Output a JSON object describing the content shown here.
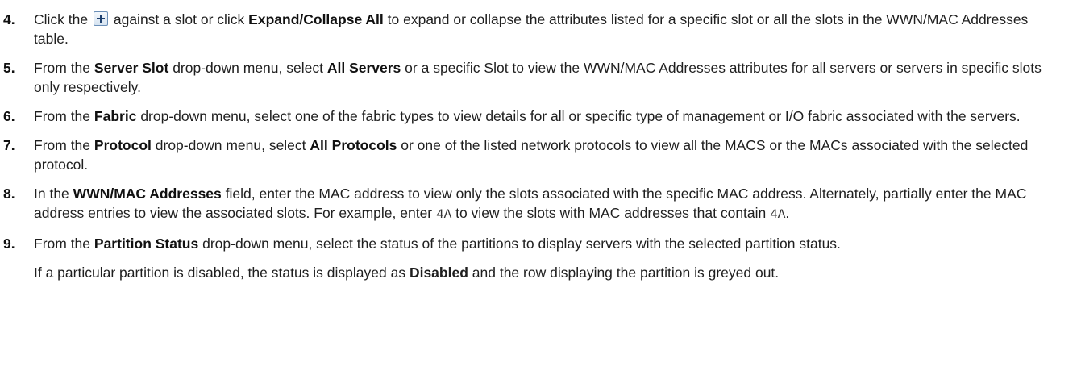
{
  "steps": [
    {
      "num": "4.",
      "parts": [
        "Click the",
        "against a slot or click",
        "Expand/Collapse All",
        "to expand or collapse the attributes listed for a specific slot or all the slots in the WWN/MAC Addresses table."
      ]
    },
    {
      "num": "5.",
      "parts": [
        "From the",
        "Server Slot",
        "drop-down menu, select",
        "All Servers",
        "or a specific Slot to view the WWN/MAC Addresses attributes for all servers or servers in specific slots only respectively."
      ]
    },
    {
      "num": "6.",
      "parts": [
        "From the",
        "Fabric",
        "drop-down menu, select one of the fabric types to view details for all or specific type of management or I/O fabric associated with the servers."
      ]
    },
    {
      "num": "7.",
      "parts": [
        "From the",
        "Protocol",
        "drop-down menu, select",
        "All Protocols",
        "or one of the listed network protocols to view all the MACS or the MACs associated with the selected protocol."
      ]
    },
    {
      "num": "8.",
      "parts": [
        "In the",
        "WWN/MAC Addresses",
        "field, enter the MAC address to view only the slots associated with the specific MAC address. Alternately, partially enter the MAC address entries to view the associated slots. For example, enter",
        "4A",
        "to view the slots with MAC addresses that contain",
        "4A",
        "."
      ]
    },
    {
      "num": "9.",
      "parts": [
        "From the",
        "Partition Status",
        "drop-down menu, select the status of the partitions to display servers with the selected partition status."
      ]
    }
  ],
  "note": {
    "parts": [
      "If a particular partition is disabled, the status is displayed as",
      "Disabled",
      "and the row displaying the partition is greyed out."
    ]
  },
  "icons": {
    "expand": "plus-icon"
  }
}
